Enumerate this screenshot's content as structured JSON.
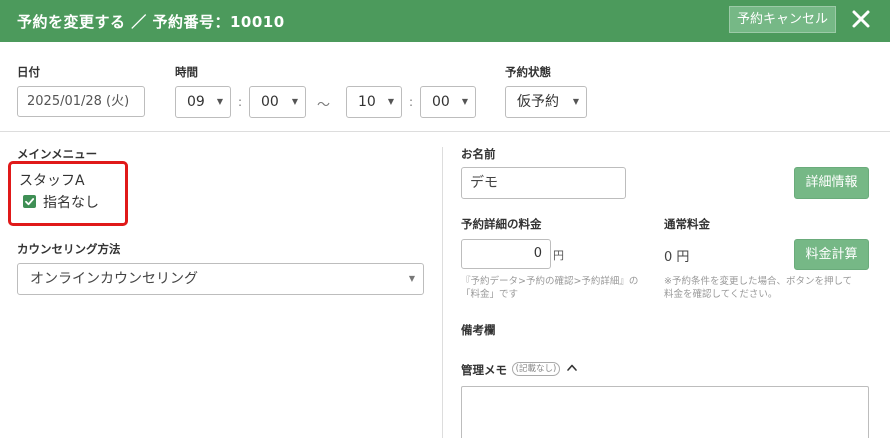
{
  "header": {
    "title": "予約を変更する ／ 予約番号：10010",
    "cancel_label": "予約キャンセル",
    "bg_color": "#4c9a5c"
  },
  "date": {
    "label": "日付",
    "value": "2025/01/28 (火)"
  },
  "time": {
    "label": "時間",
    "start_hour": "09",
    "start_minute": "00",
    "end_hour": "10",
    "end_minute": "00",
    "colon": ":",
    "tilde": "～"
  },
  "status": {
    "label": "予約状態",
    "value": "仮予約"
  },
  "main_menu": {
    "label": "メインメニュー",
    "staff": "スタッフA",
    "no_nomination_label": "指名なし",
    "no_nomination_checked": true
  },
  "counseling": {
    "label": "カウンセリング方法",
    "value": "オンラインカウンセリング"
  },
  "customer": {
    "label": "お名前",
    "value": "デモ",
    "details_button": "詳細情報"
  },
  "fee": {
    "label": "予約詳細の料金",
    "value": "0",
    "unit": "円",
    "note_line1": "『予約データ>予約の確認>予約詳細』の",
    "note_line2": "「料金」です"
  },
  "regular_fee": {
    "label": "通常料金",
    "value": "0 円",
    "calc_button": "料金計算",
    "note_line1": "※予約条件を変更した場合、ボタンを押して",
    "note_line2": "料金を確認してください。"
  },
  "remarks": {
    "label": "備考欄"
  },
  "memo": {
    "label": "管理メモ",
    "badge": "記載なし",
    "toggle": "^"
  }
}
